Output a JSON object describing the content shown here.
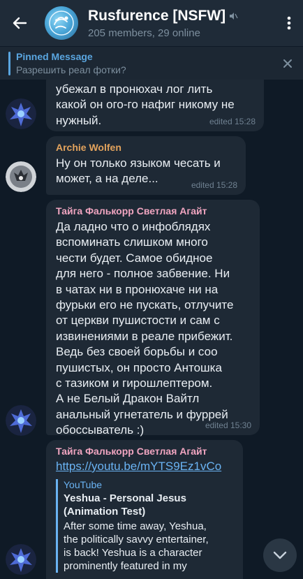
{
  "header": {
    "title": "Rusfurence [NSFW]",
    "subtitle": "205 members, 29 online",
    "icons": {
      "back": "back-arrow-icon",
      "muted": "muted-speaker-icon",
      "menu": "more-vertical-icon"
    }
  },
  "pinned": {
    "title": "Pinned Message",
    "text": "Разрешить реал фотки?",
    "close_icon": "close-icon"
  },
  "messages": [
    {
      "sender": "",
      "text": "убежал в пронюхач лог лить\nкакой он ого-го нафиг никому не\nнужный.",
      "meta": "edited 15:28"
    },
    {
      "sender": "Archie Wolfen",
      "text": "Ну он только языком чесать и\nможет, а на деле...",
      "meta": "edited 15:28"
    },
    {
      "sender": "Тайга Фалькорр Светлая Агайт",
      "text": "Да ладно что о инфоблядях\nвспоминать слишком много\nчести будет. Самое обидное\nдля него - полное забвение. Ни\nв чатах ни в пронюхаче ни на\nфурьки его не пускать, отлучите\nот церкви пушистости и сам с\nизвинениями в реале прибежит.\nВедь без своей борьбы и соо\nпушистых, он просто Антошка\nс тазиком и гирошлептером.\nА не Белый Дракон Вайтл\nанальный угнетатель и фуррей\nобоссыватель :)",
      "meta": "edited 15:30"
    },
    {
      "sender": "Тайга Фалькорр Светлая Агайт",
      "link": "https://youtu.be/mYTS9Ez1vCo",
      "preview_site": "YouTube",
      "preview_title": "Yeshua - Personal Jesus\n(Animation Test)",
      "preview_desc": "After some time away, Yeshua,\nthe politically savvy entertainer,\nis back! Yeshua is a character\nprominently featured in my"
    }
  ],
  "scroll_down_icon": "chevron-down-icon",
  "colors": {
    "header_bg": "#1f2b38",
    "chat_bg": "#0f1a26",
    "bubble_bg": "#1e2935",
    "accent": "#5aa6e0",
    "sender_orange": "#e3a35d",
    "sender_pink": "#f0a5c0"
  }
}
